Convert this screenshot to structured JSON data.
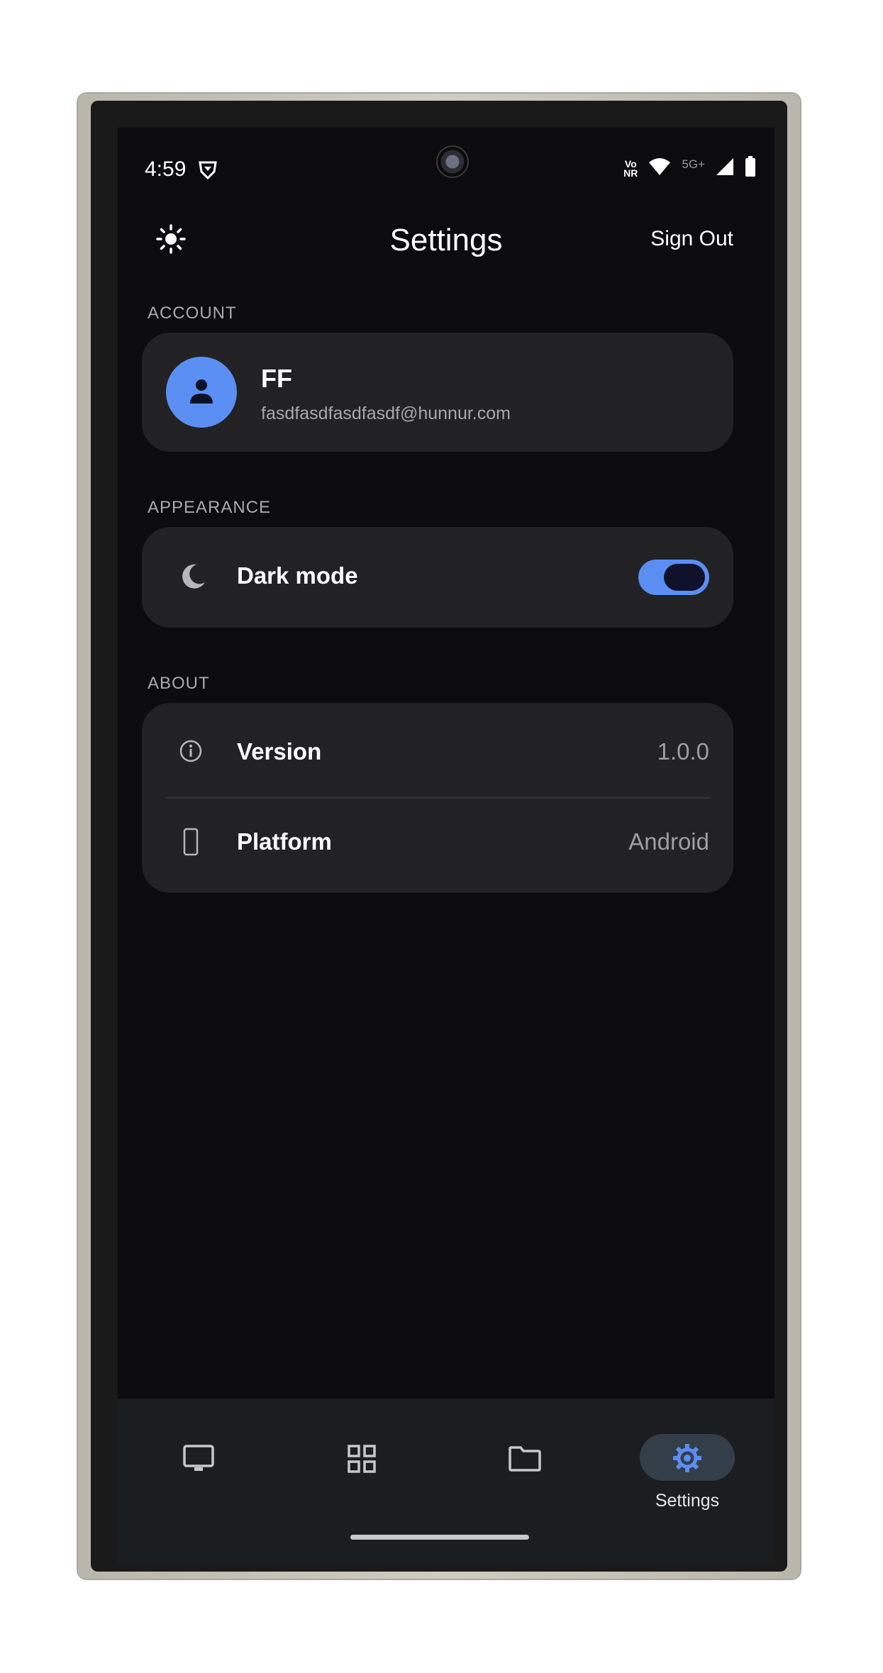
{
  "status_bar": {
    "time": "4:59",
    "volte_line1": "Vo",
    "volte_line2": "NR",
    "network": "5G+"
  },
  "header": {
    "title": "Settings",
    "sign_out": "Sign Out"
  },
  "account": {
    "section_label": "ACCOUNT",
    "name": "FF",
    "email": "fasdfasdfasdfasdf@hunnur.com"
  },
  "appearance": {
    "section_label": "APPEARANCE",
    "dark_mode_label": "Dark mode",
    "dark_mode_on": true
  },
  "about": {
    "section_label": "ABOUT",
    "rows": [
      {
        "label": "Version",
        "value": "1.0.0",
        "icon": "info-icon"
      },
      {
        "label": "Platform",
        "value": "Android",
        "icon": "phone-icon"
      }
    ]
  },
  "bottom_nav": {
    "items": [
      {
        "icon": "monitor-icon",
        "label": ""
      },
      {
        "icon": "grid-icon",
        "label": ""
      },
      {
        "icon": "folder-icon",
        "label": ""
      },
      {
        "icon": "gear-icon",
        "label": "Settings",
        "active": true
      }
    ]
  },
  "colors": {
    "accent": "#5b8ef2",
    "background": "#0c0c0e",
    "card": "#222225",
    "navbar": "#1b1e21"
  }
}
